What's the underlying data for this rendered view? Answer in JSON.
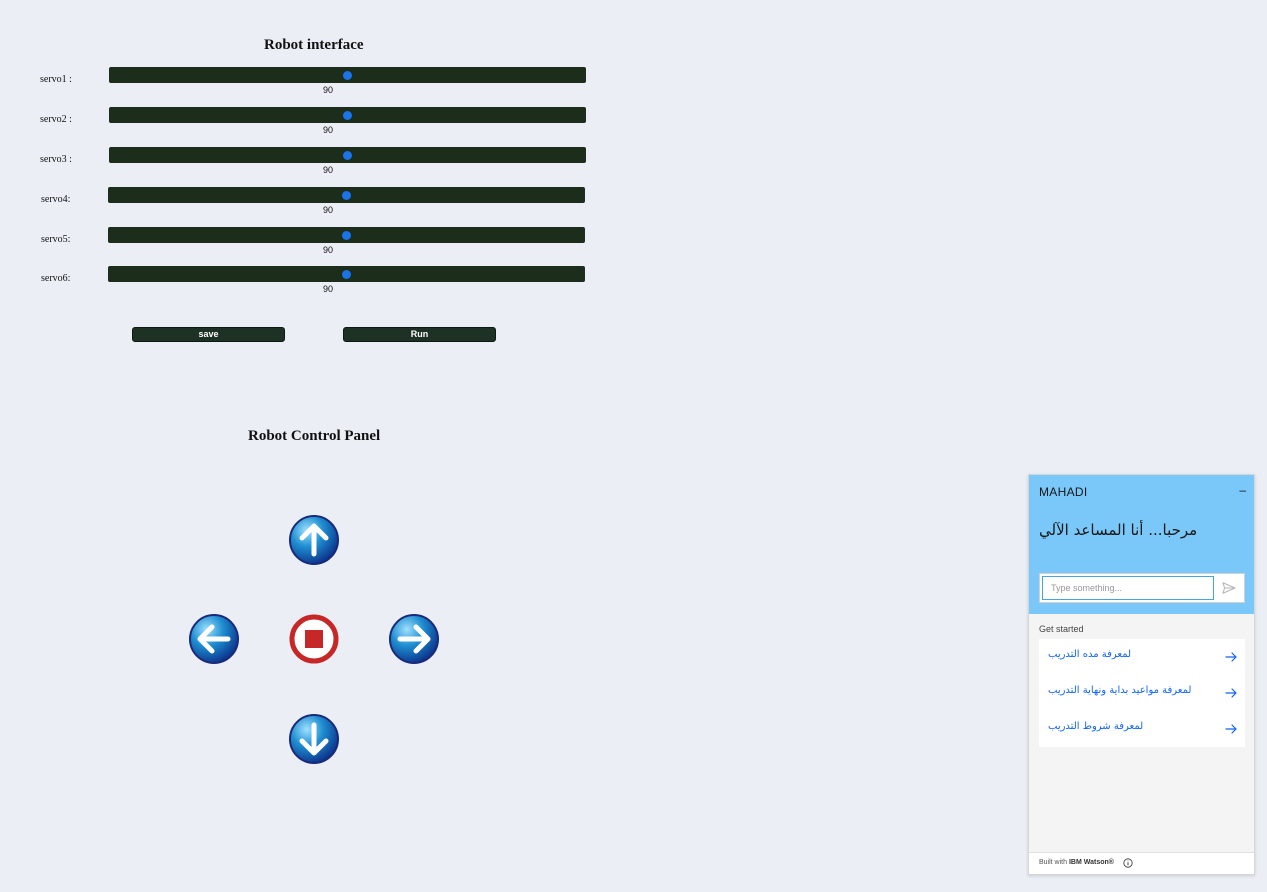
{
  "interface": {
    "title": "Robot interface",
    "servos": [
      {
        "label": "servo1 :",
        "value": "90",
        "level": 90,
        "max": 180
      },
      {
        "label": "servo2 :",
        "value": "90",
        "level": 90,
        "max": 180
      },
      {
        "label": "servo3 :",
        "value": "90",
        "level": 90,
        "max": 180
      },
      {
        "label": "servo4:",
        "value": "90",
        "level": 90,
        "max": 180
      },
      {
        "label": "servo5:",
        "value": "90",
        "level": 90,
        "max": 180
      },
      {
        "label": "servo6:",
        "value": "90",
        "level": 90,
        "max": 180
      }
    ],
    "save_label": "save",
    "run_label": "Run",
    "track_color": "#1d2d1b",
    "thumb_color": "#1a73e8"
  },
  "control_panel": {
    "title": "Robot Control Panel",
    "buttons": [
      "up-arrow-icon",
      "left-arrow-icon",
      "stop-icon",
      "right-arrow-icon",
      "down-arrow-icon"
    ]
  },
  "chat": {
    "name": "MAHADI",
    "minimize_icon": "minus-icon",
    "greeting": "مرحبا... أنا المساعد الآلي",
    "input_placeholder": "Type something...",
    "send_icon": "send-icon",
    "get_started": "Get started",
    "suggestions": [
      {
        "text": "لمعرفة مده التدريب",
        "icon": "arrow-right-icon"
      },
      {
        "text": "لمعرفة مواعيد بداية ونهاية التدريب",
        "icon": "arrow-right-icon"
      },
      {
        "text": "لمعرفة شروط التدريب",
        "icon": "arrow-right-icon"
      }
    ],
    "footer_prefix": "Built with",
    "footer_brand": "IBM Watson®",
    "header_color": "#79c8f9",
    "link_color": "#0f62fe"
  }
}
